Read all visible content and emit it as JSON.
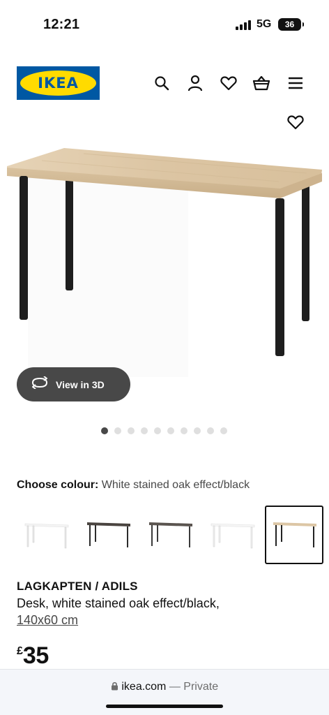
{
  "status_bar": {
    "time": "12:21",
    "network": "5G",
    "battery": "36"
  },
  "header": {
    "logo_text": "IKEA",
    "icons": [
      "search-icon",
      "account-icon",
      "favourites-icon",
      "basket-icon",
      "menu-icon"
    ]
  },
  "gallery": {
    "view_3d_label": "View in 3D",
    "dot_count": 10,
    "active_dot": 0
  },
  "colour": {
    "label": "Choose colour:",
    "value": "White stained oak effect/black",
    "swatches": [
      {
        "name": "white",
        "top": "#f3f3f3",
        "legs": "#ffffff"
      },
      {
        "name": "black-brown",
        "top": "#4a4440",
        "legs": "#2b2b2b"
      },
      {
        "name": "black-brown-grey",
        "top": "#5a544f",
        "legs": "#3a3a3a"
      },
      {
        "name": "white-white",
        "top": "#f4f4f4",
        "legs": "#f0f0f0"
      },
      {
        "name": "white-stained-oak-black",
        "top": "#dcc6a5",
        "legs": "#222222",
        "selected": true
      }
    ]
  },
  "product": {
    "name": "LAGKAPTEN / ADILS",
    "description": "Desk, white stained oak effect/black,",
    "size": "140x60 cm",
    "price_currency": "£",
    "price_value": "35"
  },
  "browser": {
    "domain": "ikea.com",
    "separator": "—",
    "mode": "Private"
  },
  "colors": {
    "ikea_blue": "#0058a3",
    "ikea_yellow": "#ffdb00",
    "button_dark": "#484848"
  }
}
